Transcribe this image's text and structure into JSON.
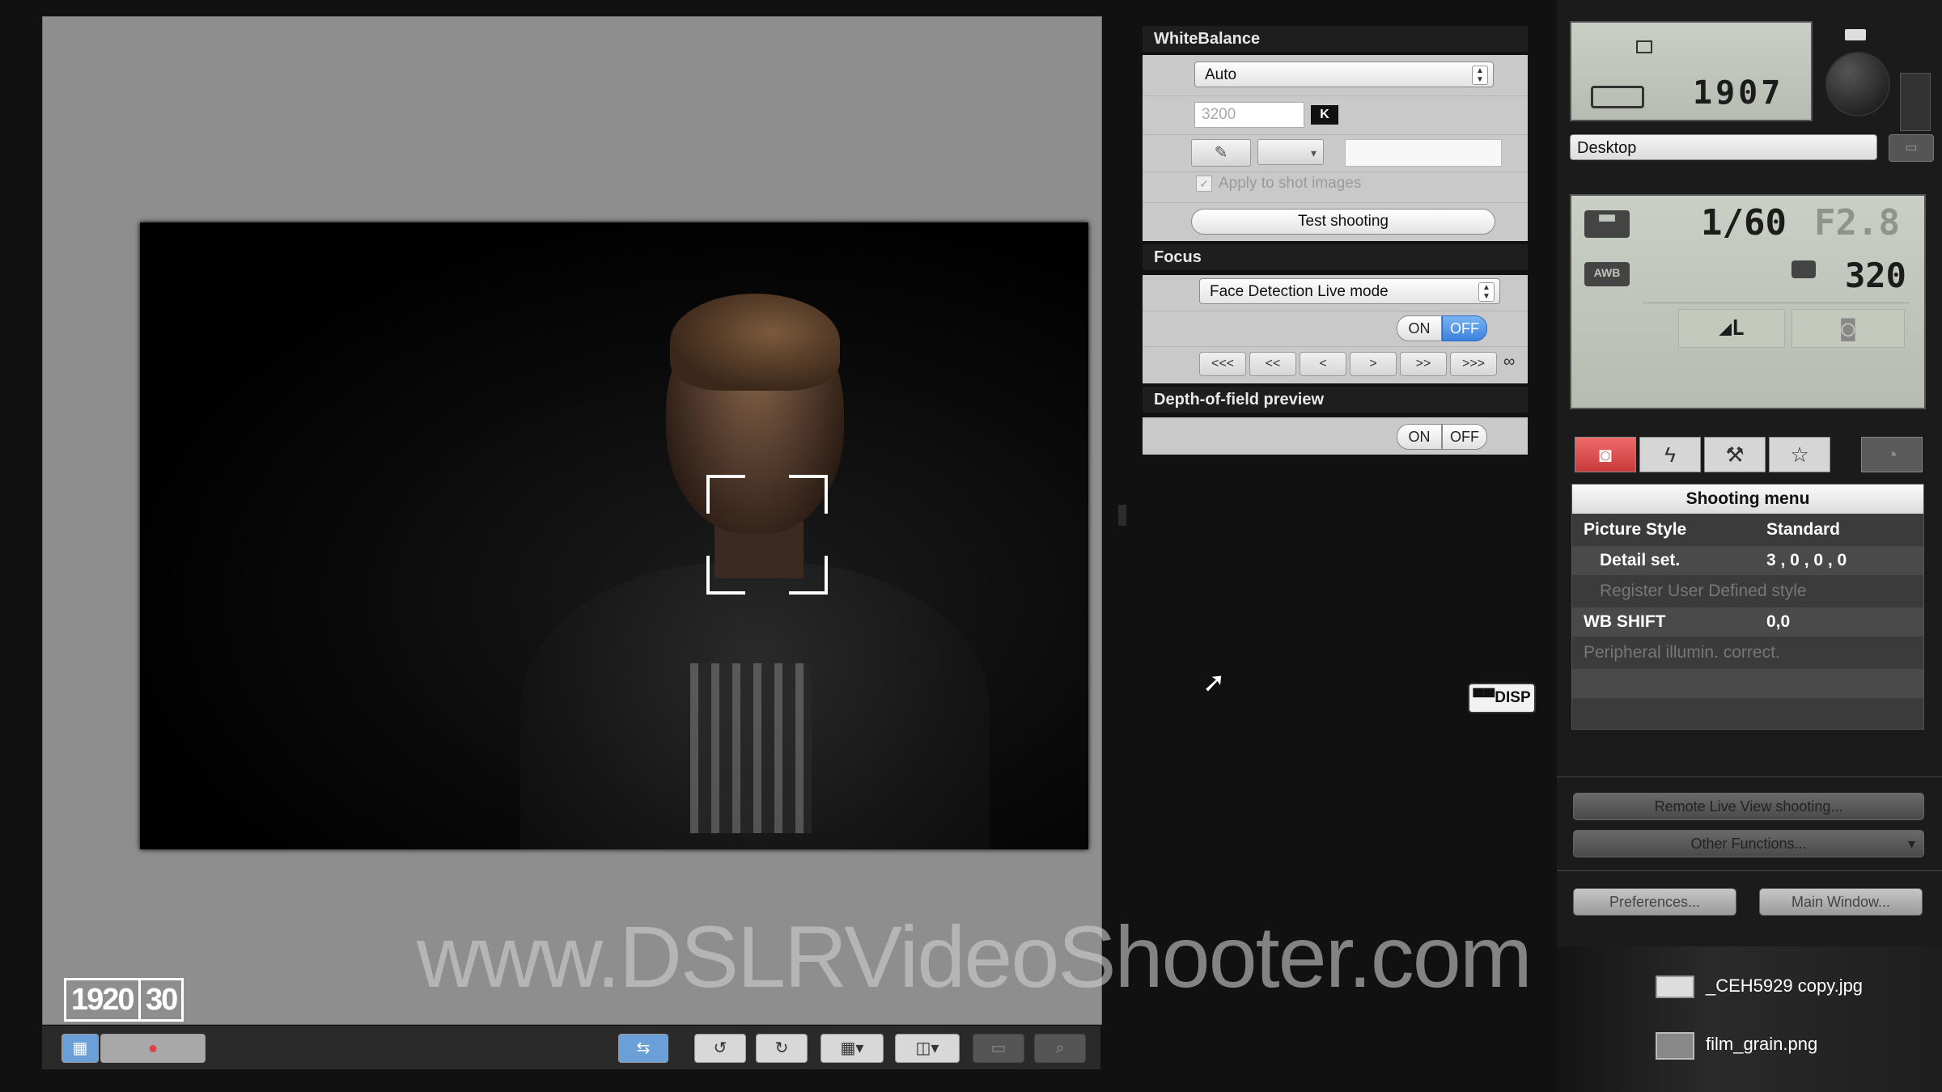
{
  "white_balance": {
    "header": "WhiteBalance",
    "mode": "Auto",
    "kelvin_value": "3200",
    "kelvin_unit": "K",
    "apply_to_shot": "Apply to shot images",
    "test_shooting": "Test shooting"
  },
  "focus": {
    "header": "Focus",
    "mode": "Face Detection Live mode",
    "on": "ON",
    "off": "OFF",
    "steps": [
      "<<<",
      "<<",
      "<",
      ">",
      ">>",
      ">>>"
    ],
    "infinity": "∞"
  },
  "dof": {
    "header": "Depth-of-field preview",
    "on": "ON",
    "off": "OFF"
  },
  "disp_button": "DISP",
  "video_badges": {
    "resolution": "1920",
    "fps": "30"
  },
  "watermark": "www.DSLRVideoShooter.com",
  "camera": {
    "shots_remaining": "1907",
    "save_destination": "Desktop",
    "shutter_speed": "1/60",
    "aperture": "F2.8",
    "iso": "320",
    "awb_label": "AWB"
  },
  "shooting_menu": {
    "title": "Shooting menu",
    "rows": [
      {
        "label": "Picture Style",
        "value": "Standard"
      },
      {
        "label": "Detail set.",
        "value": "3 , 0 , 0 , 0"
      },
      {
        "label": "Register User Defined style",
        "value": ""
      },
      {
        "label": "WB SHIFT",
        "value": "0,0"
      },
      {
        "label": "Peripheral illumin. correct.",
        "value": ""
      }
    ]
  },
  "buttons": {
    "remote_live_view": "Remote Live View shooting...",
    "other_functions": "Other Functions...",
    "preferences": "Preferences...",
    "main_window": "Main Window..."
  },
  "desktop_files": [
    {
      "name": "_CEH5929 copy.jpg"
    },
    {
      "name": "film_grain.png"
    }
  ]
}
